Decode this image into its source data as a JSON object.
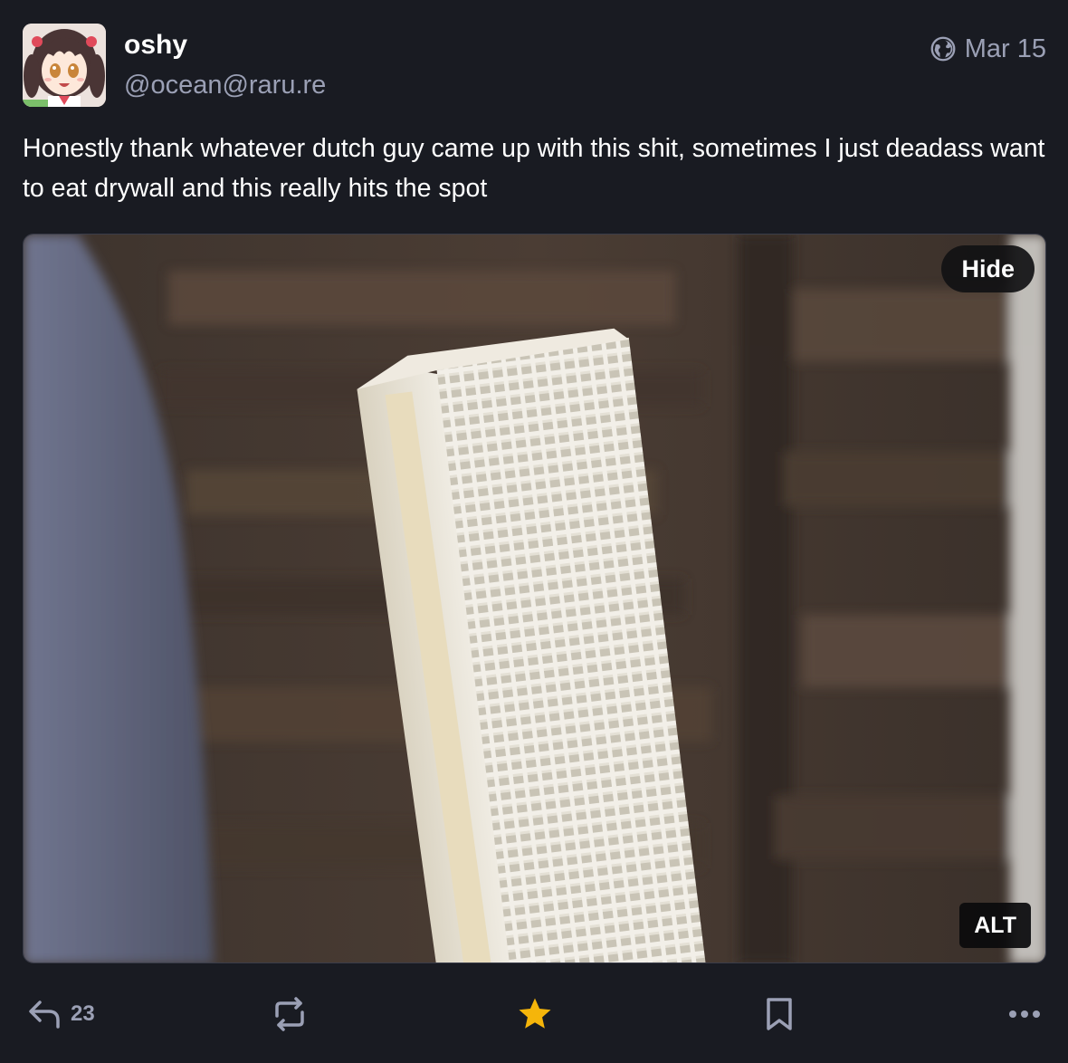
{
  "author": {
    "display_name": "oshy",
    "handle": "@ocean@raru.re"
  },
  "meta": {
    "visibility_icon": "globe-icon",
    "date": "Mar 15"
  },
  "status": {
    "text": "Honestly thank whatever dutch guy came up with this shit, sometimes I just deadass want to eat drywall and this really hits the spot"
  },
  "media": {
    "hide_label": "Hide",
    "alt_label": "ALT"
  },
  "actions": {
    "reply_count": "23",
    "reply_icon": "reply-icon",
    "boost_icon": "boost-icon",
    "favourite_icon": "star-icon",
    "bookmark_icon": "bookmark-icon",
    "more_icon": "more-icon"
  },
  "colors": {
    "background": "#191b22",
    "secondary_text": "#9ba0b5",
    "favourite_active": "#f5b50a"
  }
}
